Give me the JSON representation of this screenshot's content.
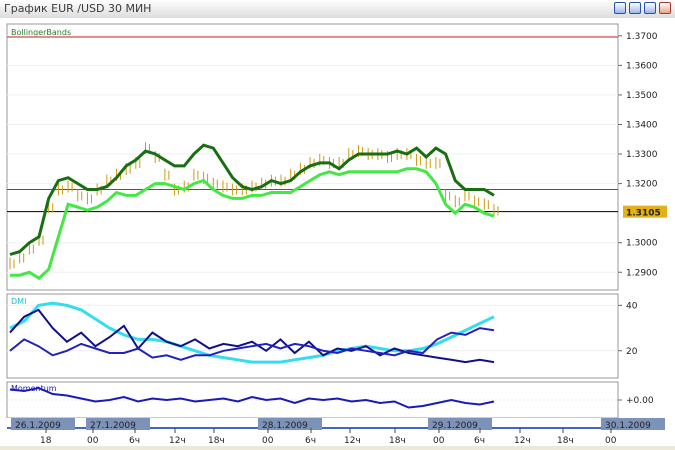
{
  "window": {
    "title": "График EUR /USD  30 МИН"
  },
  "panels": {
    "main": {
      "name": "BollingerBands",
      "y_ticks": [
        "1.3700",
        "1.3600",
        "1.3500",
        "1.3400",
        "1.3300",
        "1.3200",
        "1.3000",
        "1.2900"
      ],
      "price_label": "1.3105",
      "colors": {
        "upper": "#1a6e12",
        "lower": "#44e844",
        "price": "#cc9a10",
        "resistance": "#cc2222",
        "current": "#000000"
      }
    },
    "dmi": {
      "name": "DMI",
      "y_ticks": [
        "40",
        "20"
      ],
      "colors": {
        "adx": "#33ddee",
        "plus": "#10108a",
        "minus": "#2222bb"
      }
    },
    "momentum": {
      "name": "Momentum",
      "y_ticks": [
        "+0.00"
      ],
      "colors": {
        "line": "#1a1ab8"
      }
    }
  },
  "time_axis": {
    "date_labels": [
      "26.1.2009",
      "27.1.2009",
      "28.1.2009",
      "29.1.2009",
      "30.1.2009"
    ],
    "time_ticks": [
      "18",
      "00",
      "6ч",
      "12ч",
      "18ч",
      "00",
      "6ч",
      "12ч",
      "18ч",
      "00",
      "6ч",
      "12ч",
      "18ч",
      "00"
    ]
  },
  "chart_data": [
    {
      "type": "line",
      "title": "BollingerBands",
      "ylim": [
        1.284,
        1.374
      ],
      "series": [
        {
          "name": "upper",
          "values": [
            1.296,
            1.297,
            1.3,
            1.302,
            1.315,
            1.321,
            1.322,
            1.32,
            1.318,
            1.318,
            1.319,
            1.322,
            1.326,
            1.328,
            1.331,
            1.33,
            1.328,
            1.326,
            1.326,
            1.33,
            1.333,
            1.332,
            1.327,
            1.322,
            1.319,
            1.318,
            1.319,
            1.321,
            1.32,
            1.321,
            1.324,
            1.326,
            1.327,
            1.327,
            1.325,
            1.328,
            1.33,
            1.33,
            1.33,
            1.33,
            1.331,
            1.33,
            1.332,
            1.329,
            1.332,
            1.33,
            1.321,
            1.318,
            1.318,
            1.318,
            1.316
          ]
        },
        {
          "name": "lower",
          "values": [
            1.289,
            1.289,
            1.29,
            1.288,
            1.291,
            1.302,
            1.313,
            1.312,
            1.311,
            1.312,
            1.314,
            1.317,
            1.316,
            1.316,
            1.318,
            1.32,
            1.32,
            1.319,
            1.318,
            1.32,
            1.321,
            1.318,
            1.316,
            1.315,
            1.315,
            1.316,
            1.316,
            1.317,
            1.317,
            1.317,
            1.319,
            1.321,
            1.323,
            1.324,
            1.323,
            1.324,
            1.324,
            1.324,
            1.324,
            1.324,
            1.324,
            1.325,
            1.325,
            1.324,
            1.32,
            1.313,
            1.31,
            1.313,
            1.312,
            1.31,
            1.309
          ]
        },
        {
          "name": "price",
          "values": [
            1.293,
            1.295,
            1.298,
            1.301,
            1.312,
            1.318,
            1.319,
            1.316,
            1.315,
            1.318,
            1.321,
            1.323,
            1.325,
            1.327,
            1.332,
            1.329,
            1.323,
            1.318,
            1.319,
            1.323,
            1.322,
            1.32,
            1.319,
            1.318,
            1.318,
            1.319,
            1.32,
            1.321,
            1.321,
            1.323,
            1.325,
            1.327,
            1.328,
            1.327,
            1.327,
            1.33,
            1.331,
            1.33,
            1.33,
            1.329,
            1.33,
            1.33,
            1.328,
            1.327,
            1.327,
            1.316,
            1.314,
            1.316,
            1.314,
            1.313,
            1.311
          ]
        }
      ],
      "resistance_level": 1.318,
      "current_level": 1.3105
    },
    {
      "type": "line",
      "title": "DMI",
      "ylim": [
        8,
        45
      ],
      "series": [
        {
          "name": "adx",
          "values": [
            30,
            33,
            40,
            41,
            40,
            38,
            34,
            30,
            27,
            25,
            25,
            24,
            22,
            20,
            18,
            17,
            16,
            15,
            15,
            15,
            16,
            17,
            18,
            20,
            21,
            22,
            21,
            20,
            20,
            21,
            23,
            26,
            29,
            32,
            35
          ]
        },
        {
          "name": "plus",
          "values": [
            28,
            35,
            38,
            30,
            24,
            28,
            22,
            26,
            31,
            21,
            28,
            24,
            22,
            25,
            21,
            23,
            22,
            24,
            20,
            25,
            19,
            24,
            18,
            21,
            20,
            22,
            18,
            21,
            19,
            18,
            17,
            16,
            15,
            16,
            15
          ]
        },
        {
          "name": "minus",
          "values": [
            20,
            25,
            22,
            18,
            20,
            23,
            21,
            19,
            19,
            21,
            17,
            18,
            16,
            18,
            18,
            20,
            21,
            22,
            23,
            21,
            23,
            22,
            20,
            19,
            21,
            20,
            19,
            18,
            20,
            19,
            25,
            28,
            27,
            30,
            29
          ]
        }
      ]
    },
    {
      "type": "line",
      "title": "Momentum",
      "ylim": [
        -0.012,
        0.012
      ],
      "series": [
        {
          "name": "momentum",
          "values": [
            0.007,
            0.006,
            0.008,
            0.004,
            0.003,
            0.001,
            -0.001,
            0.0,
            0.002,
            -0.001,
            0.001,
            0.0,
            0.001,
            -0.001,
            0.0,
            0.001,
            -0.001,
            0.002,
            0.0,
            0.001,
            -0.002,
            0.001,
            0.0,
            0.001,
            -0.001,
            0.0,
            -0.002,
            -0.001,
            -0.005,
            -0.004,
            -0.002,
            0.0,
            -0.002,
            -0.003,
            -0.001
          ]
        }
      ]
    }
  ]
}
